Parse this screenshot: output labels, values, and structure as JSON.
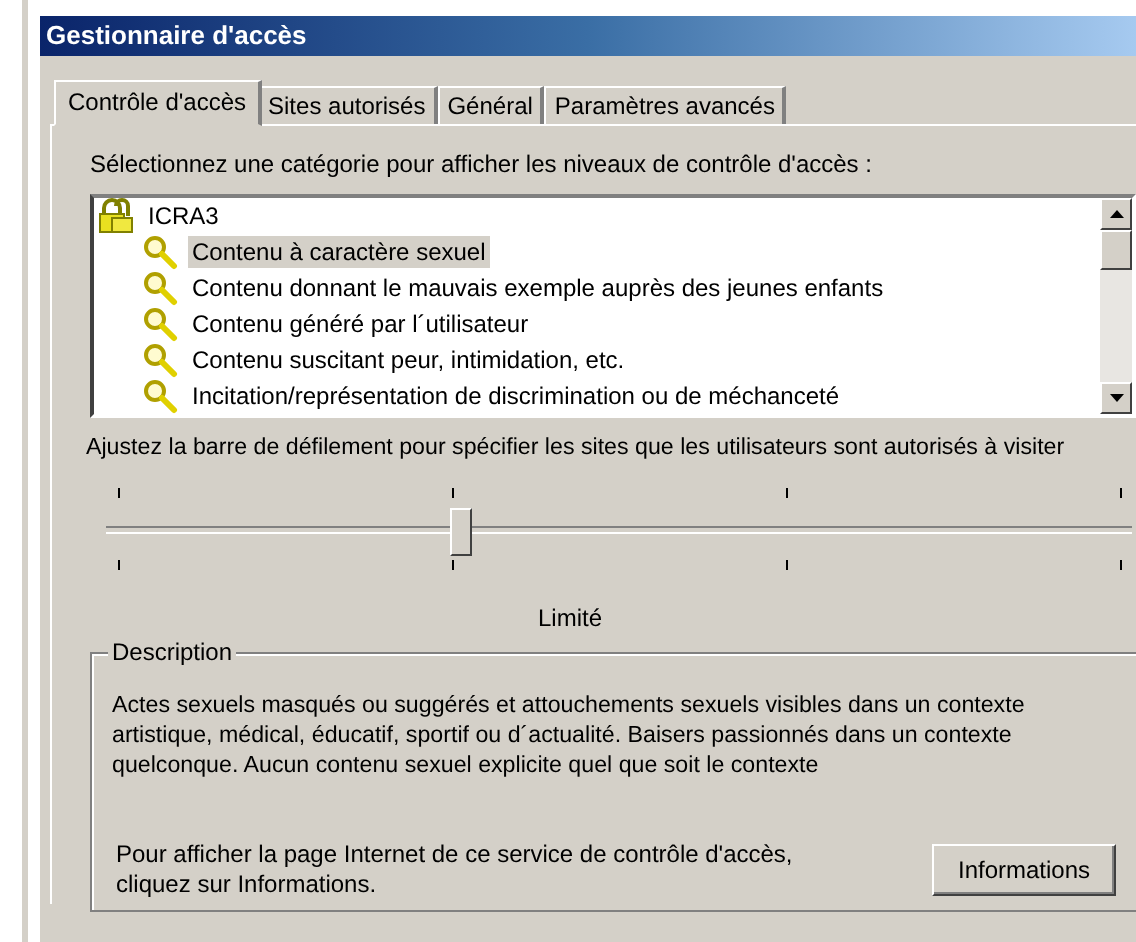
{
  "window": {
    "title": "Gestionnaire d'accès"
  },
  "tabs": [
    {
      "label": "Contrôle d'accès",
      "selected": true
    },
    {
      "label": "Sites autorisés",
      "selected": false
    },
    {
      "label": "Général",
      "selected": false
    },
    {
      "label": "Paramètres avancés",
      "selected": false
    }
  ],
  "category_prompt": "Sélectionnez une catégorie pour afficher les niveaux de contrôle d'accès :",
  "tree": [
    {
      "label": "ICRA3",
      "kind": "lock",
      "selected": false,
      "children": [
        {
          "label": "Contenu à caractère sexuel",
          "kind": "key",
          "selected": true
        },
        {
          "label": "Contenu donnant le mauvais exemple auprès des jeunes enfants",
          "kind": "key",
          "selected": false
        },
        {
          "label": "Contenu généré par l´utilisateur",
          "kind": "key",
          "selected": false
        },
        {
          "label": "Contenu suscitant peur, intimidation, etc.",
          "kind": "key",
          "selected": false
        },
        {
          "label": "Incitation/représentation de discrimination ou de méchanceté",
          "kind": "key",
          "selected": false
        }
      ]
    }
  ],
  "slider_prompt": "Ajustez la barre de défilement pour spécifier les sites que les utilisateurs sont autorisés à visiter",
  "slider": {
    "level": 0.3333
  },
  "level_label": "Limité",
  "description": {
    "title": "Description",
    "text": "Actes sexuels masqués ou suggérés et attouchements sexuels visibles dans un contexte artistique, médical, éducatif, sportif ou d´actualité. Baisers passionnés dans un contexte quelconque. Aucun contenu sexuel explicite quel que soit le contexte"
  },
  "info_text": "Pour afficher la page Internet de ce service de contrôle d'accès, cliquez sur Informations.",
  "info_button": "Informations"
}
